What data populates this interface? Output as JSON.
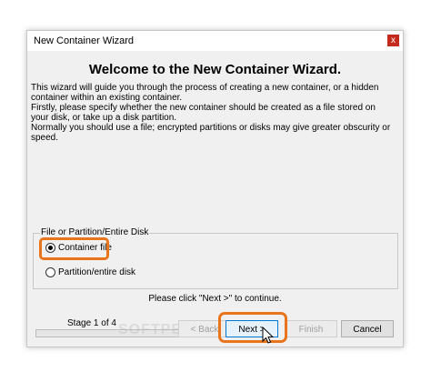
{
  "window": {
    "title": "New Container Wizard",
    "close_glyph": "x"
  },
  "heading": "Welcome to the New Container Wizard.",
  "intro": {
    "p1": "This wizard will guide you through the process of creating a new container, or a hidden container within an existing container.",
    "p2": "Firstly, please specify whether the new container should be created as a file stored on your disk, or take up a disk partition.",
    "p3": "Normally you should use a file; encrypted partitions or  disks may give greater obscurity or speed."
  },
  "group": {
    "label": "File or Partition/Entire Disk",
    "options": [
      {
        "label": "Container file",
        "selected": true
      },
      {
        "label": "Partition/entire disk",
        "selected": false
      }
    ]
  },
  "hint": "Please click \"Next >\" to continue.",
  "stage": "Stage 1 of 4",
  "progress": 0,
  "watermark": "SOFTPEDIA",
  "buttons": {
    "back": "< Back",
    "next": "Next >",
    "finish": "Finish",
    "cancel": "Cancel"
  },
  "colors": {
    "highlight": "#e8741c",
    "close": "#c42b1c"
  },
  "icons": {
    "cursor": "mouse-pointer-icon"
  }
}
